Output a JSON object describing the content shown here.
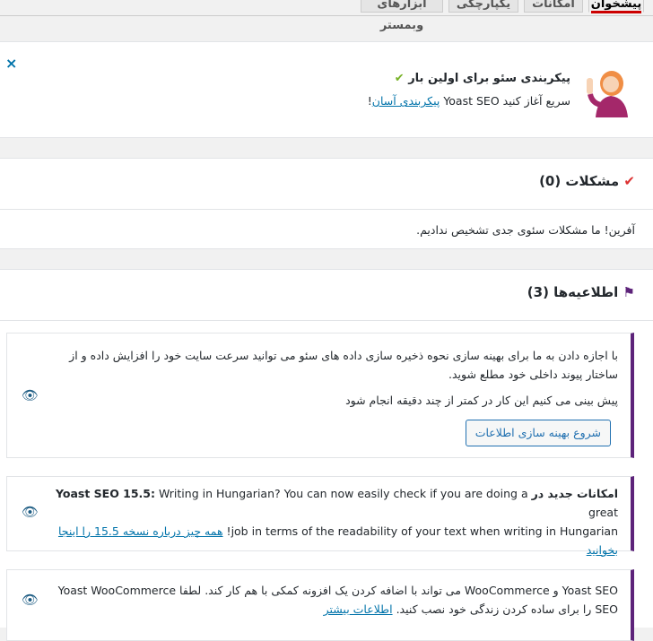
{
  "tabs": [
    {
      "label": "پیشخوان",
      "active": true
    },
    {
      "label": "امکانات",
      "active": false
    },
    {
      "label": "یکپارچگی",
      "active": false
    },
    {
      "label": "ابزارهای وبمستر",
      "active": false
    }
  ],
  "config_notice": {
    "title": "پیکربندی سئو برای اولین بار",
    "check_mark": "✔",
    "subtitle_prefix": "سریع آغاز کنید Yoast SEO",
    "subtitle_link": "پیکربندی آسان",
    "subtitle_suffix": "!",
    "close": "×"
  },
  "problems": {
    "heading": "مشکلات (0)",
    "message": "آفرین! ما مشکلات سئوی جدی تشخیص ندادیم."
  },
  "notifications": {
    "heading": "اطلاعیه‌ها (3)",
    "items": [
      {
        "line1": "با اجازه دادن به ما برای بهینه سازی نحوه ذخیره سازی داده های سئو می توانید سرعت سایت خود را افزایش داده و از",
        "line2": "ساختار پیوند داخلی خود مطلع شوید.",
        "line3": "پیش بینی می کنیم این کار در کمتر از چند دقیقه انجام شود",
        "button": "شروع بهینه سازی اطلاعات"
      },
      {
        "bold_prefix": "امکانات جدید در",
        "bold_product": "Yoast SEO 15.5:",
        "text": " Writing in Hungarian? You can now easily check if you are doing a great",
        "text2": "job in terms of the readability of your text when writing in Hungarian!",
        "link1": "همه چیز درباره نسخه 15.5 را اینجا",
        "link2": "بخوانید"
      },
      {
        "line1": "Yoast SEO و WooCommerce می تواند با اضافه کردن یک افزونه کمکی با هم کار کند. لطفا Yoast WooCommerce",
        "line2_start": "SEO",
        "line2_mid": "را برای ساده کردن زندگی خود نصب کنید.",
        "link": "اطلاعات بیشتر"
      }
    ]
  }
}
